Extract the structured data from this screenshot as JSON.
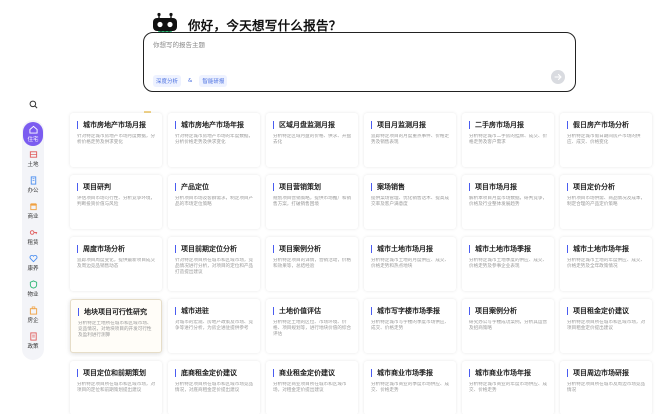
{
  "header": {
    "greeting": "你好，今天想写什么报告？"
  },
  "prompt": {
    "placeholder": "你想写的报告主题",
    "chips": [
      "深度分析",
      "&",
      "智能研报"
    ]
  },
  "sidebar": {
    "items": [
      {
        "label": "住宅",
        "icon": "home-icon",
        "active": true
      },
      {
        "label": "土地",
        "icon": "land-icon"
      },
      {
        "label": "办公",
        "icon": "office-icon"
      },
      {
        "label": "商业",
        "icon": "shop-icon"
      },
      {
        "label": "租赁",
        "icon": "key-icon"
      },
      {
        "label": "康养",
        "icon": "health-icon"
      },
      {
        "label": "物业",
        "icon": "property-icon"
      },
      {
        "label": "房企",
        "icon": "company-icon"
      },
      {
        "label": "政策",
        "icon": "policy-icon"
      }
    ]
  },
  "colors": {
    "accent": "#7b5cf0",
    "title_bar": "#4a5cf0"
  },
  "cards": [
    {
      "title": "城市房地产市场月报",
      "desc": "针对特定城市房地产市场月度数据，分析价格走势及供求变化"
    },
    {
      "title": "城市房地产市场年报",
      "desc": "针对特定城市房地产市场的年度数据，分析价格走势及供求变化"
    },
    {
      "title": "区域月盘监测月报",
      "desc": "分析特定区域月盘的价格、供求、开盘去化"
    },
    {
      "title": "项目月监测月报",
      "desc": "追踪特定项目的月度重点事件、价格走势及销售表现"
    },
    {
      "title": "二手房市场月报",
      "desc": "分析特定城市二手房的挂牌、成交、价格走势及客户需求"
    },
    {
      "title": "假日房产市场分析",
      "desc": "分析特定城市假日期间房产市场的供应、成交、价格变化"
    },
    {
      "title": "项目研判",
      "desc": "评估项目市场可行性、分析竞争环境，判断投资价值与风险"
    },
    {
      "title": "产品定位",
      "desc": "分析项目市场及客群需求，制定项目产品的市场定位策略"
    },
    {
      "title": "项目营销策划",
      "desc": "规划项目营销策略，提供市场推广和销售方案，打破销售困境"
    },
    {
      "title": "案场销售",
      "desc": "提供案场管理、优化销售话术、提高成交率及客户满意度"
    },
    {
      "title": "项目市场月报",
      "desc": "解析本项目月度市场数据，研判竞争，价格及行业整体发展趋势"
    },
    {
      "title": "项目定价分析",
      "desc": "分析项目市场供需、商品情况及成本，制定合理的产品定价策略"
    },
    {
      "title": "周度市场分析",
      "desc": "追踪项目周度变化，提供最新项目成交及周边竞品销售动态"
    },
    {
      "title": "项目前期定位分析",
      "desc": "针对特定项目所在城市和区域市场，竞品情况进行分析，对项目的定位和产品打造提出建议"
    },
    {
      "title": "项目案例分析",
      "desc": "分析特定项目的详情，营销活动，价格和效果等，总结经验"
    },
    {
      "title": "城市土地市场月报",
      "desc": "分析特定城市土地的月度供应、成交、价格走势和热点地块"
    },
    {
      "title": "城市土地市场季报",
      "desc": "分析特定城市土地季度的供应、成交、价格走势及参事企业表现"
    },
    {
      "title": "城市土地市场年报",
      "desc": "分析特定城市土地的年度供应、成交、价格走势及全年政策情况"
    },
    {
      "title": "地块项目可行性研究",
      "desc": "分析特定土地所在城市和区域市场、竞品情况，对地块项目的开发可行性及盈利进行测算"
    },
    {
      "title": "城市进驻",
      "desc": "对城市的宏观、房地产政策及市场、竞争等进行分析，为房企进驻提供参考"
    },
    {
      "title": "土地价值评估",
      "desc": "分析特定土地的区位、市场环境、价格、项目规划等，进行地块价值的综合评估"
    },
    {
      "title": "城市写字楼市场季报",
      "desc": "分析特定城市写字楼的季度市场供应、成交、价格走势"
    },
    {
      "title": "项目案例分析",
      "desc": "研究办公写字楼成功案例，分析其运营及招商策略"
    },
    {
      "title": "项目租金定价建议",
      "desc": "分析特定项目所在城市和区域市场，对项目租金定价提出建议"
    },
    {
      "title": "项目定位和前期策划",
      "desc": "分析特定项目所在城市和区域市场，对项目的定位和前期策划提出建议"
    },
    {
      "title": "底商租金定价建议",
      "desc": "分析特定项目所在城市和区域市场竞品情况，对底商租金定价提出建议"
    },
    {
      "title": "商业租金定价建议",
      "desc": "分析特定商业项目所在城市和区域市场，对租金定价提出建议"
    },
    {
      "title": "城市商业市场季报",
      "desc": "分析特定城市商业的季度市场供应、成交、价格走势"
    },
    {
      "title": "城市商业市场年报",
      "desc": "分析特定城市商业的年度市场供应、成交、价格走势"
    },
    {
      "title": "项目周边市场研报",
      "desc": "分析特定项目所在城市及周边市场竞品情况"
    }
  ]
}
